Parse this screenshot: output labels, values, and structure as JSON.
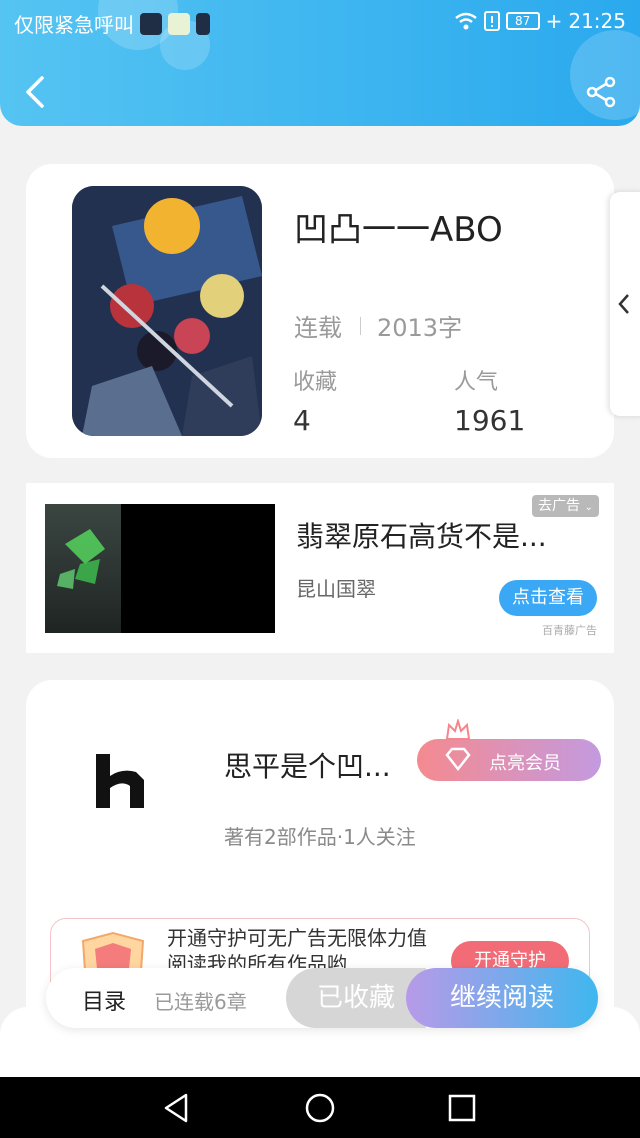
{
  "statusbar": {
    "left_text": "仅限紧急呼叫",
    "battery": "87",
    "time": "21:25",
    "icons": [
      "app-icon",
      "wechat-icon",
      "sim-icon",
      "wifi-icon",
      "sim-alert-icon",
      "battery-icon",
      "charging-icon"
    ]
  },
  "header": {
    "back_icon": "back-arrow-icon",
    "share_icon": "share-icon",
    "colors": {
      "start": "#55c4f2",
      "end": "#2aa9ee"
    }
  },
  "book": {
    "title": "凹凸一一ABO",
    "status": "连载",
    "word_count": "2013字",
    "favorites_label": "收藏",
    "favorites": "4",
    "popularity_label": "人气",
    "popularity": "1961"
  },
  "side_tab": {
    "icon": "chevron-left-icon"
  },
  "ad": {
    "title": "翡翠原石高货不是...",
    "source": "昆山国翠",
    "remove_label": "去广告",
    "button": "点击查看",
    "mark": "百青藤广告"
  },
  "author": {
    "name": "思平是个凹...",
    "info": "著有2部作品·1人关注",
    "vip_button": "点亮会员",
    "guard_text": "开通守护可无广告无限体力值阅读我的所有作品哟",
    "guard_button": "开通守护"
  },
  "bottom_bar": {
    "toc": "目录",
    "chapters": "已连载6章",
    "favorited": "已收藏",
    "continue": "继续阅读"
  },
  "navbar": {
    "icons": [
      "back-triangle-icon",
      "home-circle-icon",
      "recents-square-icon"
    ]
  }
}
